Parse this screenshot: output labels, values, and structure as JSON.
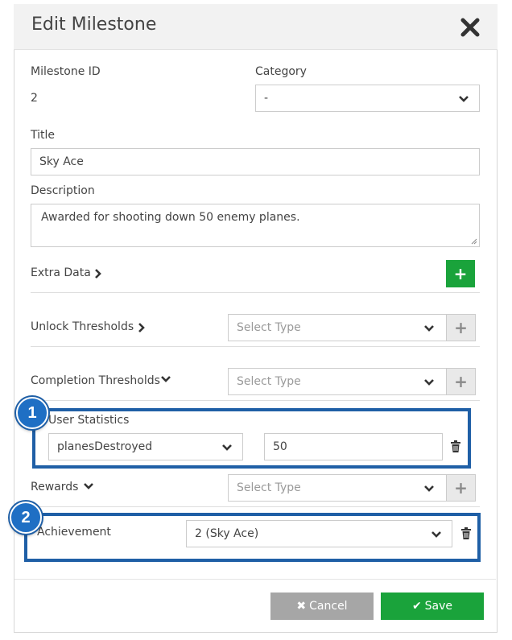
{
  "modal": {
    "title": "Edit Milestone"
  },
  "fields": {
    "milestone_id_label": "Milestone ID",
    "milestone_id_value": "2",
    "category_label": "Category",
    "category_value": "-",
    "title_label": "Title",
    "title_value": "Sky Ace",
    "description_label": "Description",
    "description_value": "Awarded for shooting down 50 enemy planes."
  },
  "sections": {
    "extra_data_label": "Extra Data",
    "extra_data_add": "+",
    "unlock_thresholds_label": "Unlock Thresholds",
    "unlock_select_placeholder": "Select Type",
    "completion_thresholds_label": "Completion Thresholds",
    "completion_select_placeholder": "Select Type",
    "user_statistics_label": "User Statistics",
    "stat_select_value": "planesDestroyed",
    "stat_value": "50",
    "rewards_label": "Rewards",
    "rewards_select_placeholder": "Select Type",
    "achievement_label": "Achievement",
    "achievement_value": "2 (Sky Ace)",
    "add_symbol": "+"
  },
  "callouts": {
    "one": "1",
    "two": "2"
  },
  "footer": {
    "cancel_label": "Cancel",
    "save_label": "Save"
  },
  "colors": {
    "accent_green": "#1aa33b",
    "cancel_gray": "#a6a6a6",
    "callout_blue": "#1f5fa6"
  }
}
